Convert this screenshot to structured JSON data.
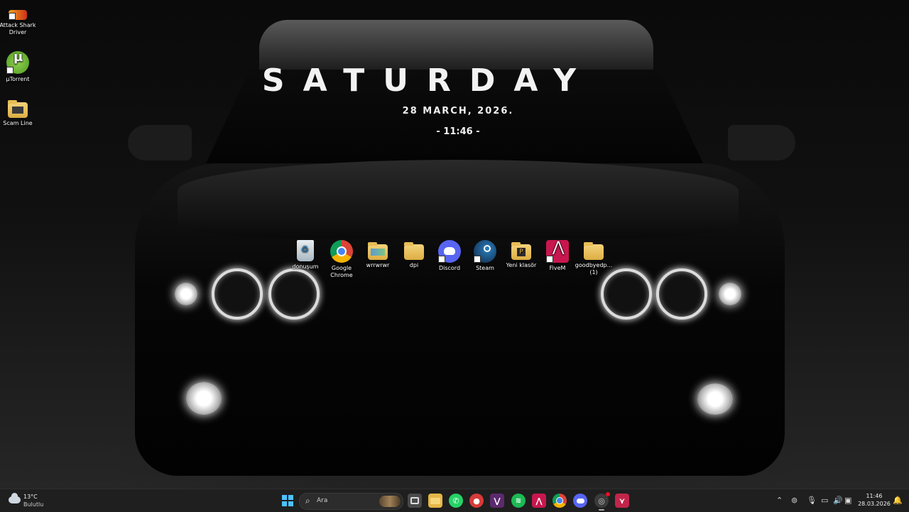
{
  "widget": {
    "day": "SATURDAY",
    "date": "28 MARCH, 2026.",
    "time": "- 11:46 -"
  },
  "left_icons": [
    {
      "label": "Attack Shark Driver",
      "icon": "attack-shark-icon"
    },
    {
      "label": "µTorrent",
      "icon": "utorrent-icon"
    },
    {
      "label": "Scam Line",
      "icon": "folder-icon"
    }
  ],
  "center_icons": [
    {
      "label": "donuşum",
      "icon": "recycle-bin-icon"
    },
    {
      "label": "Google Chrome",
      "icon": "chrome-icon"
    },
    {
      "label": "wrrwrwr",
      "icon": "folder-icon"
    },
    {
      "label": "dpi",
      "icon": "folder-icon"
    },
    {
      "label": "Discord",
      "icon": "discord-icon"
    },
    {
      "label": "Steam",
      "icon": "steam-icon"
    },
    {
      "label": "Yeni klasör",
      "icon": "folder-icon"
    },
    {
      "label": "FiveM",
      "icon": "fivem-icon"
    },
    {
      "label": "goodbyedp... (1)",
      "icon": "folder-icon"
    }
  ],
  "taskbar": {
    "weather": {
      "temp": "13°C",
      "condition": "Bulutlu"
    },
    "search_placeholder": "Ara",
    "clock_time": "11:46",
    "clock_date": "28.03.2026",
    "colors": {
      "whatsapp": "#25d366",
      "spotify": "#1db954",
      "discord": "#5865f2",
      "fivem": "#e0245e",
      "start": "#3aa0f0"
    }
  }
}
